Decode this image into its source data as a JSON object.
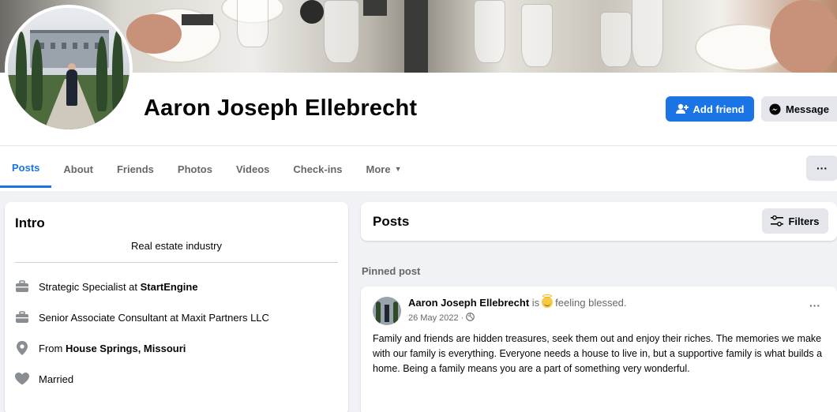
{
  "profile": {
    "name": "Aaron Joseph Ellebrecht",
    "add_friend_label": "Add friend",
    "message_label": "Message"
  },
  "tabs": [
    {
      "label": "Posts",
      "active": true
    },
    {
      "label": "About"
    },
    {
      "label": "Friends"
    },
    {
      "label": "Photos"
    },
    {
      "label": "Videos"
    },
    {
      "label": "Check-ins"
    },
    {
      "label": "More"
    }
  ],
  "more_menu_label": "···",
  "intro": {
    "title": "Intro",
    "bio": "Real estate industry",
    "items": [
      {
        "icon": "briefcase-icon",
        "prefix": "Strategic Specialist at ",
        "bold": "StartEngine"
      },
      {
        "icon": "briefcase-icon",
        "prefix": "Senior Associate Consultant at Maxit Partners LLC",
        "bold": ""
      },
      {
        "icon": "location-pin-icon",
        "prefix": "From ",
        "bold": "House Springs, Missouri"
      },
      {
        "icon": "heart-icon",
        "prefix": "Married",
        "bold": ""
      }
    ]
  },
  "posts_header": {
    "title": "Posts",
    "filters_label": "Filters"
  },
  "pinned_label": "Pinned post",
  "post": {
    "author": "Aaron Joseph Ellebrecht",
    "is_word": "is",
    "feeling": "feeling blessed.",
    "date": "26 May 2022 ·",
    "text": "Family and friends are hidden treasures, seek them out and enjoy their riches. The memories we make with our family is everything. Everyone needs a house to live in, but a supportive family is what builds a home. Being a family means you are a part of something very wonderful."
  },
  "colors": {
    "accent": "#1b74e4",
    "background": "#f0f2f5",
    "secondary_text": "#65676b"
  }
}
